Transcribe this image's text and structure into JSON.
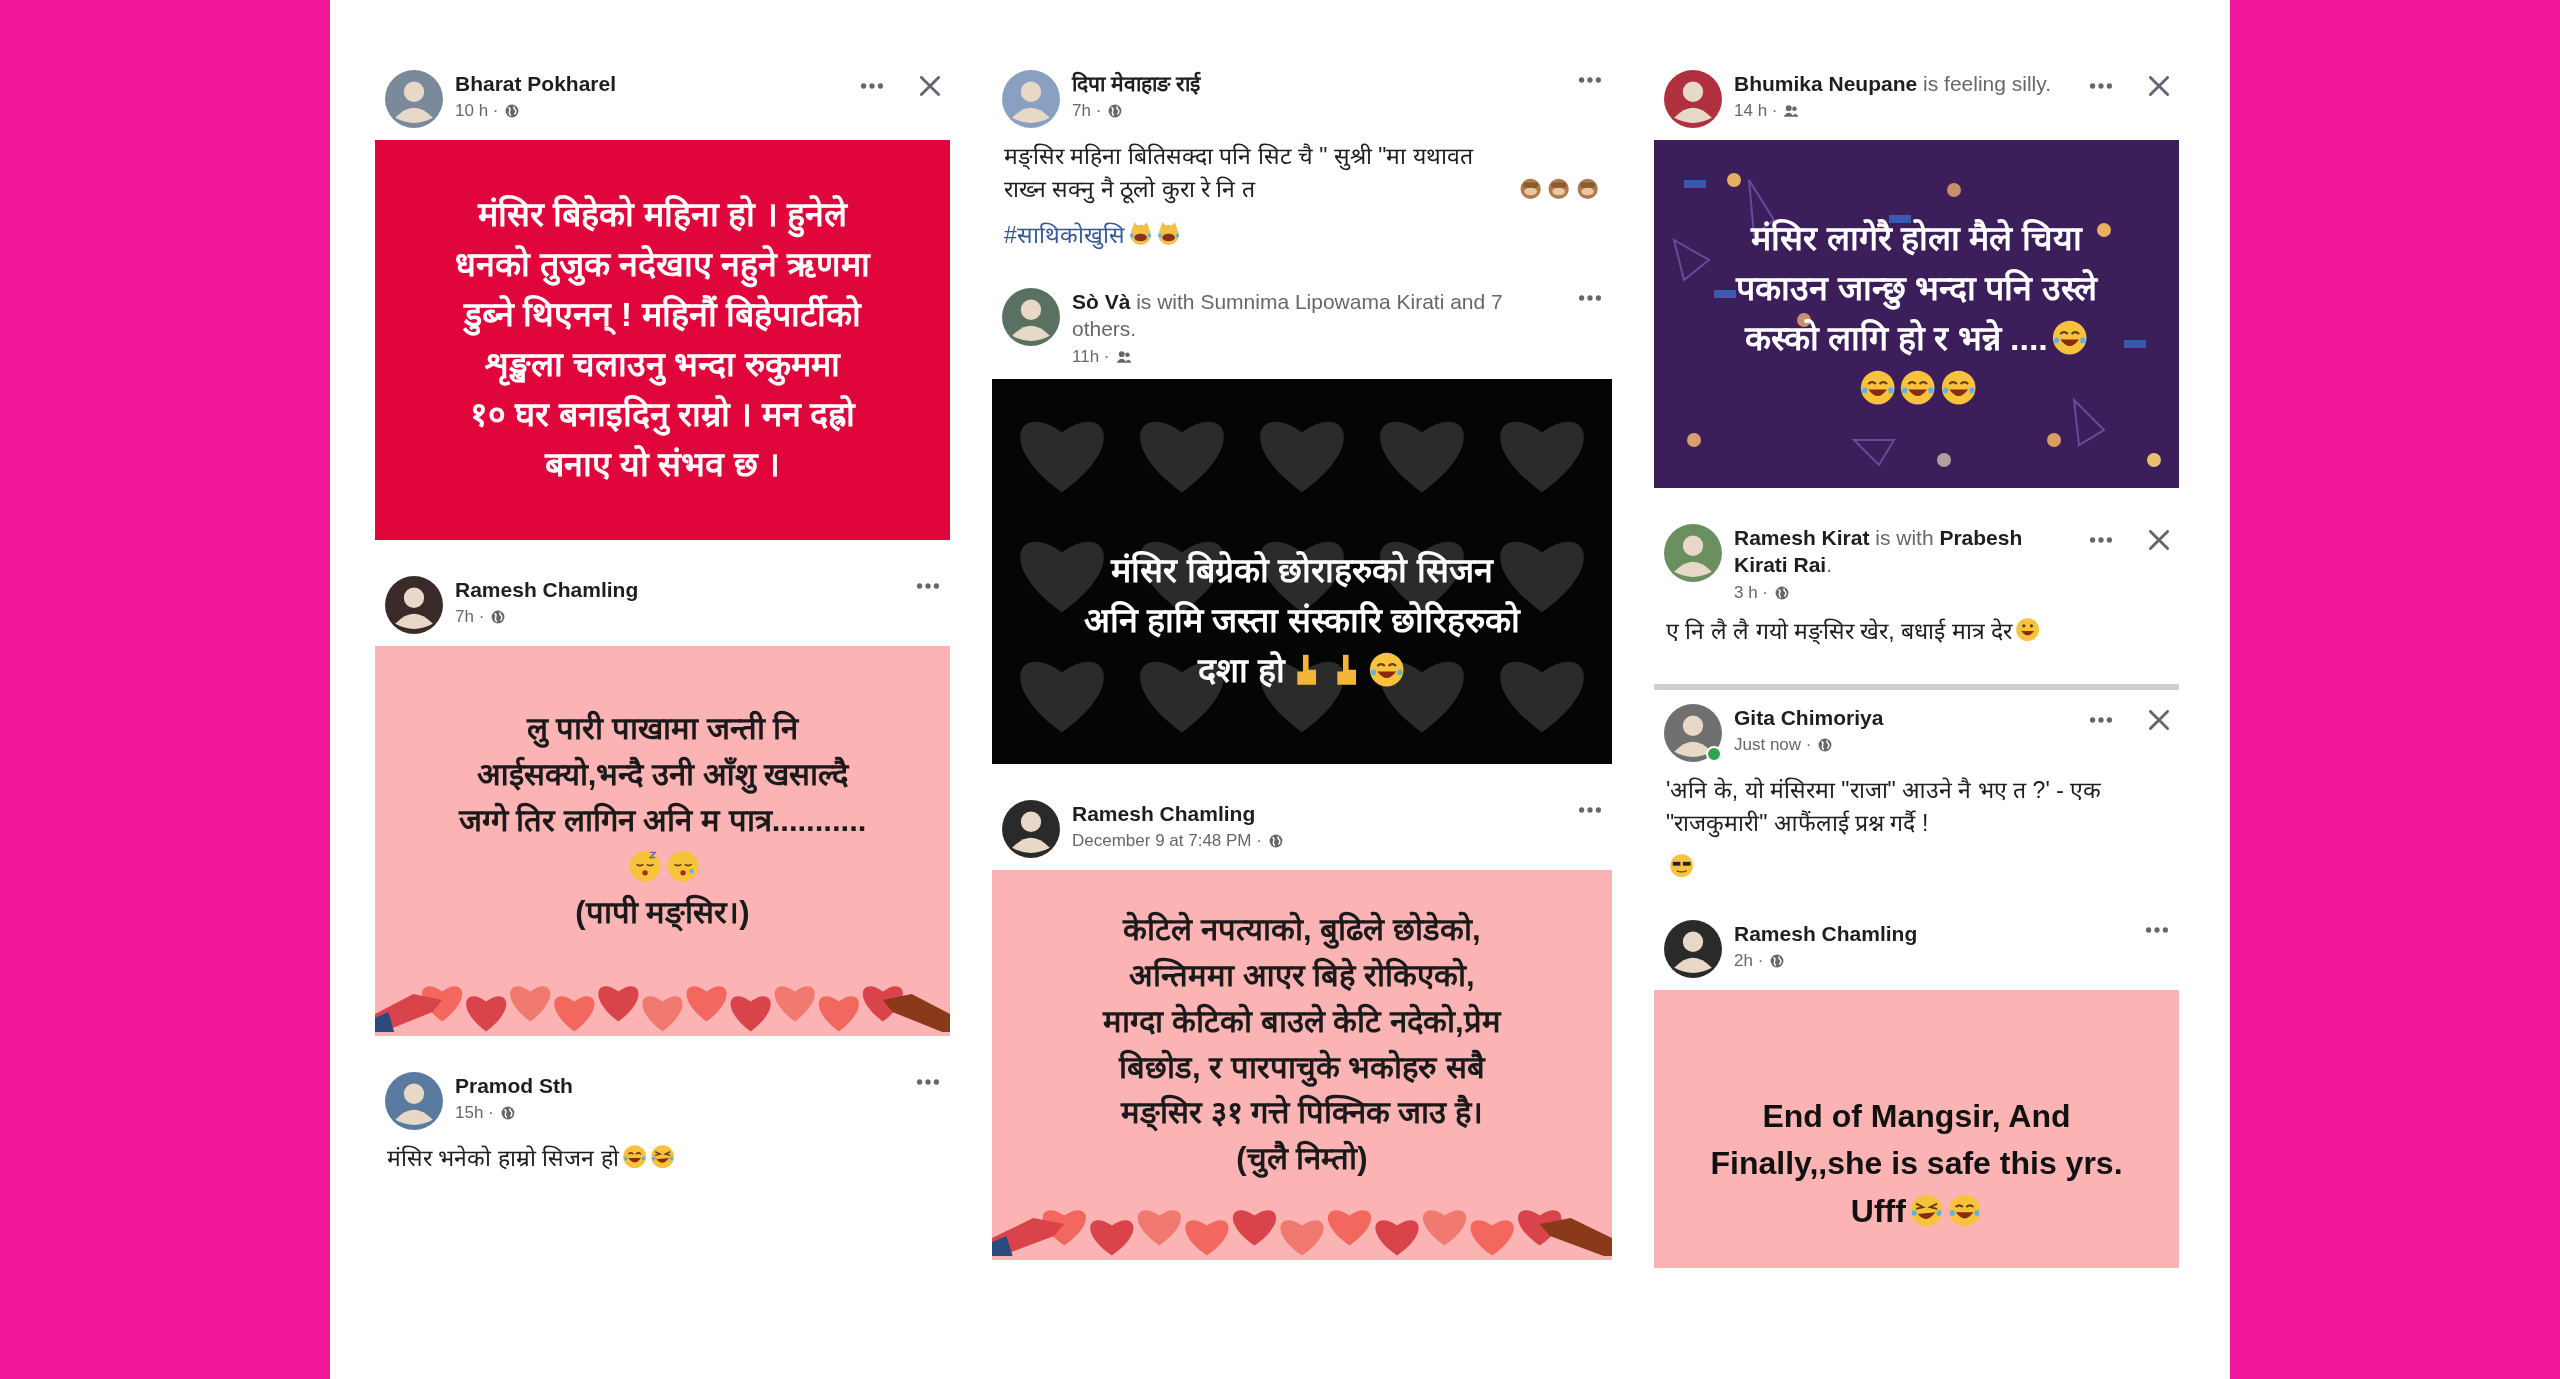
{
  "columns": [
    {
      "posts": [
        {
          "author": "Bharat Pokharel",
          "time": "10 h ·",
          "privacy": {
            "kind": "public"
          },
          "online": false,
          "close": true,
          "card": {
            "kind": "red",
            "lines": [
              {
                "text": "मंसिर बिहेको महिना हो । हुनेले"
              },
              {
                "text": "धनको तुजुक नदेखाए नहुने ऋणमा"
              },
              {
                "text": "डुब्ने थिएनन् ! महिनौं बिहेपार्टीको"
              },
              {
                "text": "शृङ्खला चलाउनु भन्दा रुकुममा"
              },
              {
                "text": "१० घर बनाइदिनु राम्रो । मन दह्रो"
              },
              {
                "text": "बनाए यो संभव छ ।"
              }
            ]
          }
        },
        {
          "author": "Ramesh Chamling",
          "time": "7h ·",
          "privacy": {
            "kind": "public"
          },
          "online": false,
          "close": false,
          "card": {
            "kind": "hearts",
            "lines": [
              {
                "text": "लु पारी पाखामा जन्ती नि"
              },
              {
                "text": "आईसक्यो,भन्दै उनी आँशु खसाल्दै"
              },
              {
                "text": "जग्गे तिर लागिन अनि म पात्र..........."
              },
              {
                "emoji": [
                  {
                    "kind": "sleeping"
                  },
                  {
                    "kind": "sleepy"
                  }
                ]
              },
              {
                "text": "(पापी मङ्सिर।)"
              }
            ]
          }
        },
        {
          "author": "Pramod Sth",
          "time": "15h ·",
          "privacy": {
            "kind": "public"
          },
          "online": false,
          "close": false,
          "body": [
            {
              "text": "मंसिर भनेको हाम्रो सिजन हो",
              "emoji": [
                {
                  "kind": "joy"
                },
                {
                  "kind": "rofl"
                }
              ]
            }
          ]
        }
      ]
    },
    {
      "posts": [
        {
          "author": "दिपा मेवाहाङ राई",
          "time": "7h ·",
          "privacy": {
            "kind": "public"
          },
          "online": false,
          "close": false,
          "body": [
            {
              "text": "मङ्सिर  महिना बितिसक्दा पनि  सिट चै \" सुश्री \"मा यथावत राख्न सक्नु  नै ठूलो कुरा रे नि त",
              "emoji": [
                {
                  "kind": "monkey"
                },
                {
                  "kind": "monkey"
                },
                {
                  "kind": "monkey"
                }
              ]
            }
          ],
          "hashtag": {
            "text": "#साथिकोखुसि",
            "emoji": [
              {
                "kind": "cat"
              },
              {
                "kind": "cat"
              }
            ]
          }
        },
        {
          "author": "Sò Và",
          "activity": "is with Sumnima Lipowama Kirati and 7 others.",
          "time": "11h ·",
          "privacy": {
            "kind": "friends"
          },
          "online": false,
          "close": false,
          "card": {
            "kind": "dark",
            "lines": [
              {
                "text": "मंसिर बिग्रेको छोराहरुको सिजन"
              },
              {
                "text": "अनि हामि जस्ता संस्कारि छोरिहरुको"
              },
              {
                "text": "दशा हो",
                "emoji": [
                  {
                    "kind": "point-up"
                  },
                  {
                    "kind": "point-up"
                  },
                  {
                    "kind": "joy"
                  }
                ]
              }
            ]
          }
        },
        {
          "author": "Ramesh Chamling",
          "time": "December 9 at 7:48 PM ·",
          "privacy": {
            "kind": "public"
          },
          "online": false,
          "close": false,
          "card": {
            "kind": "hearts",
            "lines": [
              {
                "text": "केटिले नपत्याको, बुढिले छोडेको,"
              },
              {
                "text": "अन्तिममा आएर बिहे रोकिएको,"
              },
              {
                "text": "माग्दा केटिको बाउले केटि नदेको,प्रेम"
              },
              {
                "text": "बिछोड, र पारपाचुके भकोहरु सबै"
              },
              {
                "text": "मङ्सिर ३१ गत्ते पिक्निक जाउ है।"
              },
              {
                "text": "(चुलै निम्तो)"
              }
            ]
          }
        }
      ]
    },
    {
      "posts": [
        {
          "author": "Bhumika Neupane",
          "activity": "is feeling silly.",
          "time": "14 h ·",
          "privacy": {
            "kind": "friends"
          },
          "online": false,
          "close": true,
          "card": {
            "kind": "confetti",
            "lines": [
              {
                "text": "मंसिर लागेरै होला मैले चिया"
              },
              {
                "text": "पकाउन जान्छु भन्दा पनि उस्ले"
              },
              {
                "text": "कस्को लागि हो र भन्ने ....",
                "emoji": [
                  {
                    "kind": "joy"
                  }
                ]
              },
              {
                "emoji": [
                  {
                    "kind": "joy"
                  },
                  {
                    "kind": "joy"
                  },
                  {
                    "kind": "joy"
                  }
                ]
              }
            ]
          }
        },
        {
          "author": "Ramesh Kirat",
          "activity": "is with **Prabesh Kirati Rai**.",
          "time": "3 h ·",
          "privacy": {
            "kind": "public"
          },
          "online": false,
          "close": true,
          "body": [
            {
              "text": "ए नि लै लै गयो मङ्सिर खेर, बधाई मात्र देर",
              "emoji": [
                {
                  "kind": "grin"
                }
              ]
            }
          ]
        },
        {
          "author": "Gita Chimoriya",
          "time": "Just now ·",
          "privacy": {
            "kind": "public"
          },
          "online": true,
          "close": true,
          "body": [
            {
              "text": "'अनि के, यो मंसिरमा \"राजा\" आउने नै भए त ?' - एक \"राजकुमारी\" आफैंलाई प्रश्न गर्दै !"
            },
            {
              "emoji": [
                {
                  "kind": "sunglasses"
                }
              ]
            }
          ]
        },
        {
          "author": "Ramesh Chamling",
          "time": "2h ·",
          "privacy": {
            "kind": "public"
          },
          "online": false,
          "close": false,
          "card": {
            "kind": "plain",
            "lines": [
              {
                "text": "End of Mangsir, And"
              },
              {
                "text": "Finally,,she is safe this yrs."
              },
              {
                "text": "Ufff",
                "emoji": [
                  {
                    "kind": "rofl"
                  },
                  {
                    "kind": "joy"
                  }
                ]
              }
            ]
          }
        }
      ]
    }
  ]
}
